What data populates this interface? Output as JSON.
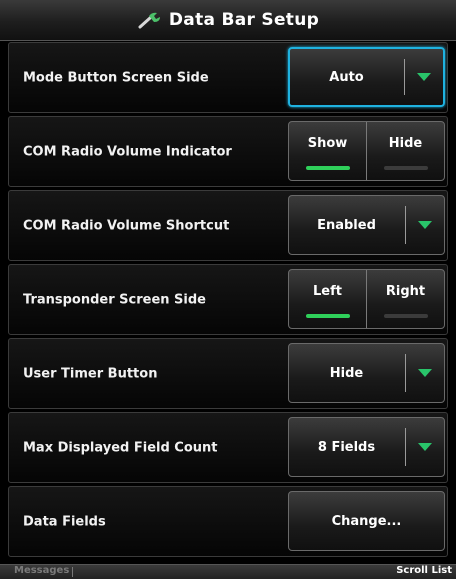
{
  "title": "Data Bar Setup",
  "rows": [
    {
      "label": "Mode Button Screen Side",
      "value": "Auto"
    },
    {
      "label": "COM Radio Volume Indicator",
      "options": [
        "Show",
        "Hide"
      ],
      "selected": "Show"
    },
    {
      "label": "COM Radio Volume Shortcut",
      "value": "Enabled"
    },
    {
      "label": "Transponder Screen Side",
      "options": [
        "Left",
        "Right"
      ],
      "selected": "Left"
    },
    {
      "label": "User Timer Button",
      "value": "Hide"
    },
    {
      "label": "Max Displayed Field Count",
      "value": "8 Fields"
    },
    {
      "label": "Data Fields",
      "button": "Change..."
    }
  ],
  "bottom": {
    "left": "Messages",
    "right": "Scroll List"
  },
  "colors": {
    "focus": "#1fb2e0",
    "indicator_on": "#2fd05a",
    "arrow": "#29c46a"
  },
  "icons": {
    "title": "wrench-icon",
    "dropdown": "chevron-down-icon"
  }
}
